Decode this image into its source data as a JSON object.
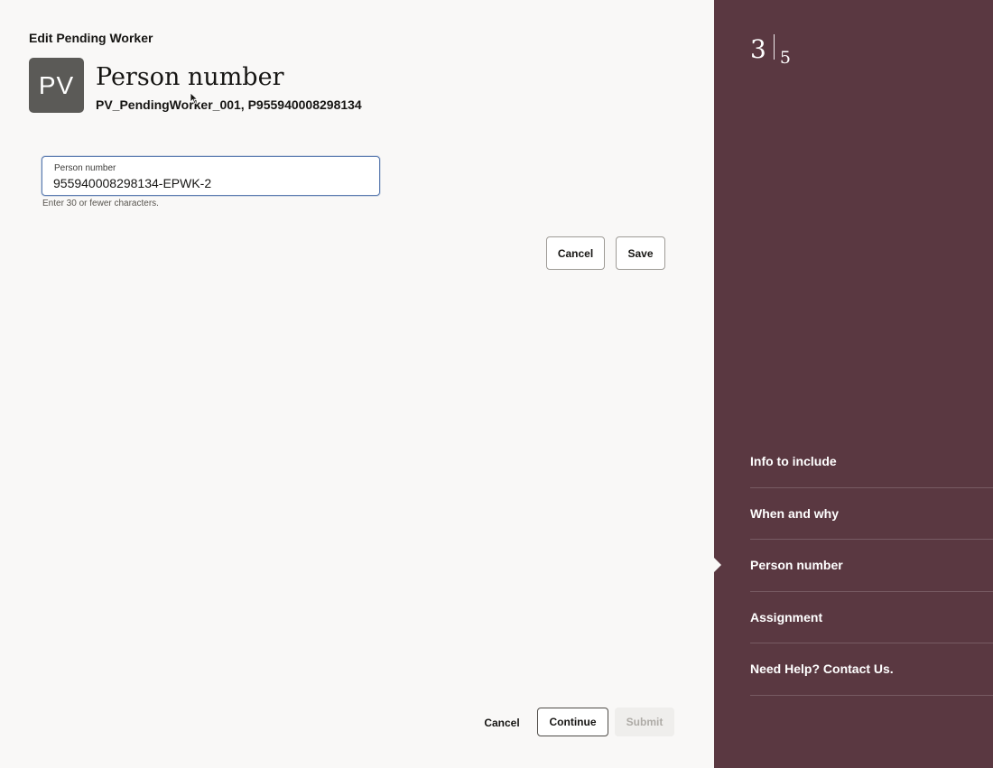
{
  "page": {
    "heading": "Edit Pending Worker",
    "avatar_initials": "PV",
    "title": "Person number",
    "subtitle": "PV_PendingWorker_001, P955940008298134"
  },
  "form": {
    "field_label": "Person number",
    "field_value": "955940008298134-EPWK-2",
    "field_help": "Enter 30 or fewer characters.",
    "cancel_label": "Cancel",
    "save_label": "Save"
  },
  "footer": {
    "cancel_label": "Cancel",
    "continue_label": "Continue",
    "submit_label": "Submit"
  },
  "side_panel": {
    "current_step": "3",
    "total_steps": "5",
    "background_color": "#5a3841",
    "steps": [
      {
        "label": "Info to include",
        "active": false
      },
      {
        "label": "When and why",
        "active": false
      },
      {
        "label": "Person number",
        "active": true
      },
      {
        "label": "Assignment",
        "active": false
      },
      {
        "label": "Need Help? Contact Us.",
        "active": false
      }
    ]
  },
  "icons": {
    "cursor": "mouse-pointer-icon",
    "active_marker": "triangle-right-icon"
  }
}
